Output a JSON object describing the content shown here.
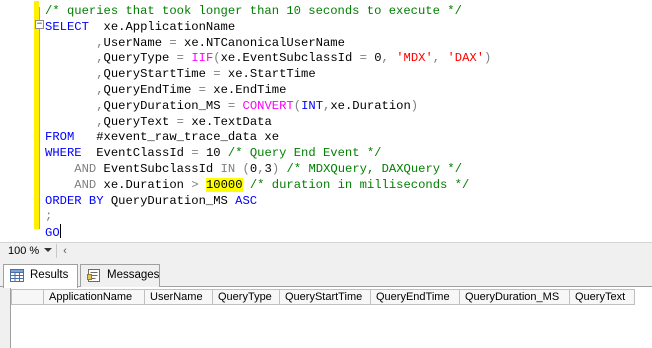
{
  "editor": {
    "lines": [
      {
        "indent": "",
        "tokens": [
          {
            "t": "/* queries that took longer than 10 seconds to execute */",
            "c": "cm"
          }
        ]
      },
      {
        "indent": "",
        "tokens": [
          {
            "t": "SELECT",
            "c": "kw"
          },
          {
            "t": "  xe.ApplicationName",
            "c": ""
          }
        ]
      },
      {
        "indent": "       ",
        "tokens": [
          {
            "t": ",",
            "c": "op"
          },
          {
            "t": "UserName ",
            "c": ""
          },
          {
            "t": "=",
            "c": "op"
          },
          {
            "t": " xe.NTCanonicalUserName",
            "c": ""
          }
        ]
      },
      {
        "indent": "       ",
        "tokens": [
          {
            "t": ",",
            "c": "op"
          },
          {
            "t": "QueryType ",
            "c": ""
          },
          {
            "t": "=",
            "c": "op"
          },
          {
            "t": " ",
            "c": ""
          },
          {
            "t": "IIF",
            "c": "fn"
          },
          {
            "t": "(",
            "c": "op"
          },
          {
            "t": "xe.EventSubclassId ",
            "c": ""
          },
          {
            "t": "=",
            "c": "op"
          },
          {
            "t": " 0",
            "c": ""
          },
          {
            "t": ",",
            "c": "op"
          },
          {
            "t": " ",
            "c": ""
          },
          {
            "t": "'MDX'",
            "c": "str"
          },
          {
            "t": ",",
            "c": "op"
          },
          {
            "t": " ",
            "c": ""
          },
          {
            "t": "'DAX'",
            "c": "str"
          },
          {
            "t": ")",
            "c": "op"
          }
        ]
      },
      {
        "indent": "       ",
        "tokens": [
          {
            "t": ",",
            "c": "op"
          },
          {
            "t": "QueryStartTime ",
            "c": ""
          },
          {
            "t": "=",
            "c": "op"
          },
          {
            "t": " xe.StartTime",
            "c": ""
          }
        ]
      },
      {
        "indent": "       ",
        "tokens": [
          {
            "t": ",",
            "c": "op"
          },
          {
            "t": "QueryEndTime ",
            "c": ""
          },
          {
            "t": "=",
            "c": "op"
          },
          {
            "t": " xe.EndTime",
            "c": ""
          }
        ]
      },
      {
        "indent": "       ",
        "tokens": [
          {
            "t": ",",
            "c": "op"
          },
          {
            "t": "QueryDuration_MS ",
            "c": ""
          },
          {
            "t": "=",
            "c": "op"
          },
          {
            "t": " ",
            "c": ""
          },
          {
            "t": "CONVERT",
            "c": "fn"
          },
          {
            "t": "(",
            "c": "op"
          },
          {
            "t": "INT",
            "c": "kw"
          },
          {
            "t": ",",
            "c": "op"
          },
          {
            "t": "xe.Duration",
            "c": ""
          },
          {
            "t": ")",
            "c": "op"
          }
        ]
      },
      {
        "indent": "       ",
        "tokens": [
          {
            "t": ",",
            "c": "op"
          },
          {
            "t": "QueryText ",
            "c": ""
          },
          {
            "t": "=",
            "c": "op"
          },
          {
            "t": " xe.TextData",
            "c": ""
          }
        ]
      },
      {
        "indent": "",
        "tokens": [
          {
            "t": "FROM",
            "c": "kw"
          },
          {
            "t": "   #xevent_raw_trace_data xe",
            "c": ""
          }
        ]
      },
      {
        "indent": "",
        "tokens": [
          {
            "t": "WHERE",
            "c": "kw"
          },
          {
            "t": "  EventClassId ",
            "c": ""
          },
          {
            "t": "=",
            "c": "op"
          },
          {
            "t": " 10 ",
            "c": ""
          },
          {
            "t": "/* Query End Event */",
            "c": "cm"
          }
        ]
      },
      {
        "indent": "    ",
        "tokens": [
          {
            "t": "AND",
            "c": "op"
          },
          {
            "t": " EventSubclassId ",
            "c": ""
          },
          {
            "t": "IN",
            "c": "op"
          },
          {
            "t": " ",
            "c": ""
          },
          {
            "t": "(",
            "c": "op"
          },
          {
            "t": "0",
            "c": ""
          },
          {
            "t": ",",
            "c": "op"
          },
          {
            "t": "3",
            "c": ""
          },
          {
            "t": ")",
            "c": "op"
          },
          {
            "t": " ",
            "c": ""
          },
          {
            "t": "/* MDXQuery, DAXQuery */",
            "c": "cm"
          }
        ]
      },
      {
        "indent": "    ",
        "tokens": [
          {
            "t": "AND",
            "c": "op"
          },
          {
            "t": " xe.Duration ",
            "c": ""
          },
          {
            "t": ">",
            "c": "op"
          },
          {
            "t": " ",
            "c": ""
          },
          {
            "t": "10000",
            "c": "hl"
          },
          {
            "t": " ",
            "c": ""
          },
          {
            "t": "/* duration in milliseconds */",
            "c": "cm"
          }
        ]
      },
      {
        "indent": "",
        "tokens": [
          {
            "t": "ORDER BY",
            "c": "kw"
          },
          {
            "t": " QueryDuration_MS ",
            "c": ""
          },
          {
            "t": "ASC",
            "c": "kw"
          }
        ]
      },
      {
        "indent": "",
        "tokens": [
          {
            "t": ";",
            "c": "op"
          }
        ]
      },
      {
        "indent": "",
        "tokens": [
          {
            "t": "GO",
            "c": "kw"
          },
          {
            "t": "",
            "c": "caret"
          }
        ]
      }
    ]
  },
  "zoom": {
    "value": "100 %"
  },
  "results": {
    "tabs": [
      {
        "id": "results",
        "label": "Results",
        "icon": "grid-icon",
        "active": true
      },
      {
        "id": "messages",
        "label": "Messages",
        "icon": "messages-icon",
        "active": false
      }
    ],
    "columns": [
      {
        "label": "ApplicationName"
      },
      {
        "label": "UserName"
      },
      {
        "label": "QueryType"
      },
      {
        "label": "QueryStartTime"
      },
      {
        "label": "QueryEndTime"
      },
      {
        "label": "QueryDuration_MS"
      },
      {
        "label": "QueryText"
      }
    ]
  },
  "colors": {
    "keyword": "#0000ff",
    "function": "#ff00ff",
    "string": "#ff0000",
    "comment": "#008000",
    "operator": "#808080",
    "highlight": "#ffff00",
    "change_bar": "#ffef00"
  }
}
